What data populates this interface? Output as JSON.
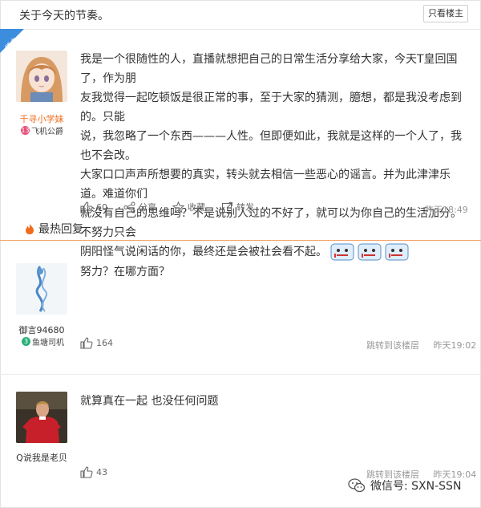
{
  "thread": {
    "title": "关于今天的节奏。",
    "only_op_label": "只看楼主"
  },
  "op": {
    "badge": "楼主",
    "username": "千寻小学妹",
    "level_num": "13",
    "level_title": "飞机公爵",
    "content_lines": [
      "我是一个很随性的人，直播就想把自己的日常生活分享给大家，今天T皇回国了，作为朋",
      "友我觉得一起吃顿饭是很正常的事，至于大家的猜测，臆想，都是我没考虑到的。只能",
      "说，我忽略了一个东西———人性。但即便如此，我就是这样的一个人了，我也不会改。",
      "大家口口声声所想要的真实，转头就去相信一些恶心的谣言。并为此津津乐道。难道你们",
      "就没有自己的思维吗？不是说别人过的不好了，就可以为你自己的生活加分。不努力只会",
      "阴阳怪气说闲话的你，最终还是会被社会看不起。"
    ],
    "like_count": "60",
    "share_label": "分享",
    "favorite_label": "收藏",
    "forward_label": "转发",
    "time": "昨天18:49"
  },
  "hot_replies_label": "最热回复",
  "replies": [
    {
      "username": "御言94680",
      "level_num": "3",
      "level_title": "鱼塘司机",
      "content": "努力？在哪方面？",
      "like_count": "164",
      "jump_label": "跳转到该楼层",
      "time": "昨天19:02"
    },
    {
      "username": "Q说我是老贝",
      "content": "就算真在一起 也没任何问题",
      "like_count": "43",
      "jump_label": "跳转到该楼层",
      "time": "昨天19:04"
    }
  ],
  "watermark": "微信号: SXN-SSN",
  "colors": {
    "accent": "#3c8dde",
    "username_op": "#f06b1c",
    "hot_line": "#f2a46b",
    "level_op": "#e6507a",
    "level_reply": "#2ab07a"
  }
}
